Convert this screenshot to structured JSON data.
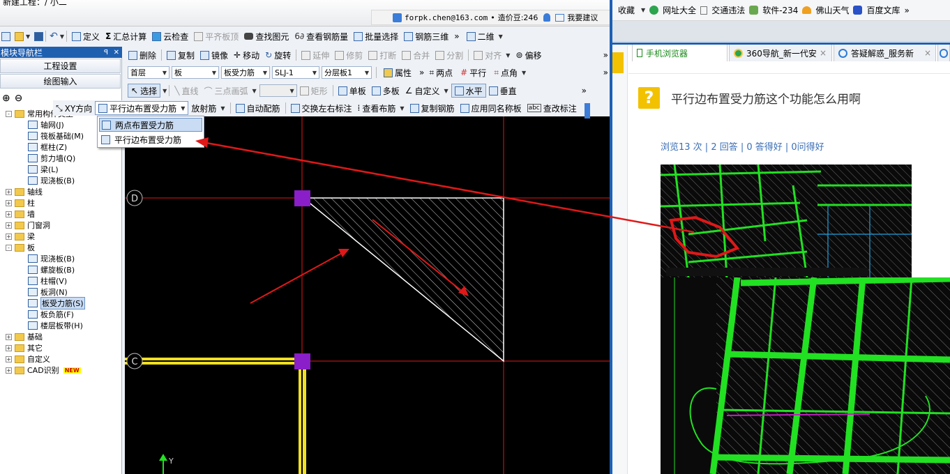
{
  "titlebar": {
    "title": "新建工程：/ 小二",
    "account": "forpk.chen@163.com",
    "bean_label": "造价豆:246",
    "suggest": "我要建议"
  },
  "toolbar1": {
    "items": [
      "定义",
      "汇总计算",
      "云检查",
      "平齐板顶",
      "查找图元",
      "查看钢筋量",
      "批量选择",
      "钢筋三维"
    ],
    "view_mode": "二维"
  },
  "toolbar2": {
    "items": [
      "删除",
      "复制",
      "镜像",
      "移动",
      "旋转",
      "延伸",
      "修剪",
      "打断",
      "合并",
      "分割",
      "对齐",
      "偏移"
    ]
  },
  "toolbar3": {
    "floor": "首层",
    "category": "板",
    "type": "板受力筋",
    "layer": "SLJ-1",
    "sublayer": "分层板1",
    "props": "属性",
    "two_point": "两点",
    "parallel": "平行",
    "point_angle": "点角"
  },
  "toolbar4": {
    "items": [
      "选择",
      "直线",
      "三点画弧",
      "矩形",
      "单板",
      "多板",
      "自定义",
      "水平",
      "垂直"
    ]
  },
  "toolbar5": {
    "items": [
      "XY方向",
      "平行边布置受力筋",
      "放射筋",
      "自动配筋",
      "交换左右标注",
      "查看布筋",
      "复制钢筋",
      "应用同名称板",
      "查改标注"
    ]
  },
  "dropdown_menu": {
    "items": [
      "两点布置受力筋",
      "平行边布置受力筋"
    ]
  },
  "nav": {
    "title": "模块导航栏",
    "pin": "ꟼ",
    "close": "✕",
    "btn_project": "工程设置",
    "btn_draw": "绘图输入",
    "tree": [
      {
        "label": "常用构件类型",
        "kind": "folder",
        "state": "-"
      },
      {
        "label": "轴网(J)",
        "kind": "item"
      },
      {
        "label": "筏板基础(M)",
        "kind": "item"
      },
      {
        "label": "框柱(Z)",
        "kind": "item"
      },
      {
        "label": "剪力墙(Q)",
        "kind": "item"
      },
      {
        "label": "梁(L)",
        "kind": "item"
      },
      {
        "label": "现浇板(B)",
        "kind": "item"
      },
      {
        "label": "轴线",
        "kind": "folder",
        "state": "+"
      },
      {
        "label": "柱",
        "kind": "folder",
        "state": "+"
      },
      {
        "label": "墙",
        "kind": "folder",
        "state": "+"
      },
      {
        "label": "门窗洞",
        "kind": "folder",
        "state": "+"
      },
      {
        "label": "梁",
        "kind": "folder",
        "state": "+"
      },
      {
        "label": "板",
        "kind": "folder",
        "state": "-"
      },
      {
        "label": "现浇板(B)",
        "kind": "item"
      },
      {
        "label": "螺旋板(B)",
        "kind": "item"
      },
      {
        "label": "柱帽(V)",
        "kind": "item"
      },
      {
        "label": "板洞(N)",
        "kind": "item"
      },
      {
        "label": "板受力筋(S)",
        "kind": "item",
        "selected": true
      },
      {
        "label": "板负筋(F)",
        "kind": "item"
      },
      {
        "label": "楼层板带(H)",
        "kind": "item"
      },
      {
        "label": "基础",
        "kind": "folder",
        "state": "+"
      },
      {
        "label": "其它",
        "kind": "folder",
        "state": "+"
      },
      {
        "label": "自定义",
        "kind": "folder",
        "state": "+"
      },
      {
        "label": "CAD识别",
        "kind": "folder",
        "state": "+",
        "badge": "NEW"
      }
    ]
  },
  "canvas": {
    "axis_d": "D",
    "axis_c": "C",
    "y_label": "Y"
  },
  "browser": {
    "favorites_label": "收藏",
    "bookmarks": [
      "网址大全",
      "交通违法",
      "软件-234",
      "佛山天气",
      "百度文库"
    ],
    "tabs": [
      "手机浏览器",
      "360导航_新一代安",
      "答疑解惑_服务新"
    ],
    "question": "平行边布置受力筋这个功能怎么用啊",
    "stats": "浏览13 次 | 2 回答 | 0 答得好 | 0问得好"
  },
  "colors": {
    "accent": "#1e60b4",
    "red": "#e01818",
    "green": "#22e022",
    "canvas": "#000000",
    "purple": "#8a1ec8"
  }
}
